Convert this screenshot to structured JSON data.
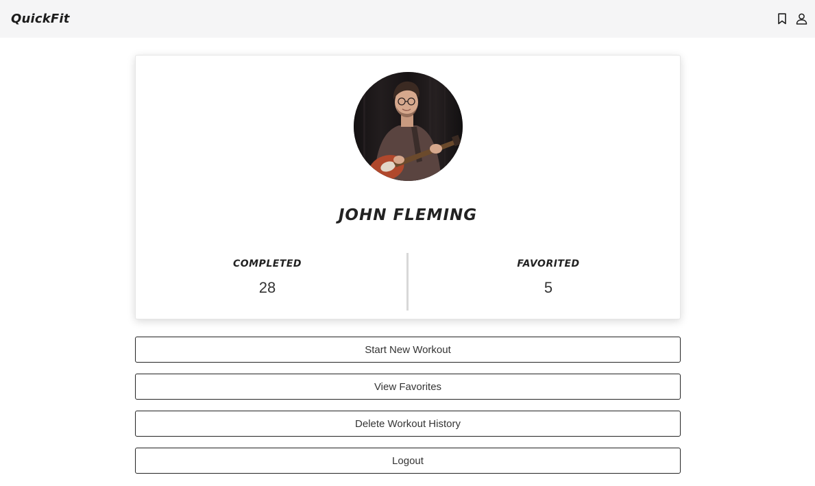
{
  "app": {
    "brand": "QuickFit"
  },
  "navbar": {
    "icons": [
      "bookmark-icon",
      "user-icon"
    ]
  },
  "profile": {
    "name": "JOHN FLEMING",
    "avatar": "profile-photo",
    "stats": {
      "completed_label": "COMPLETED",
      "completed_value": "28",
      "favorited_label": "FAVORITED",
      "favorited_value": "5"
    }
  },
  "actions": {
    "start_new_workout": "Start New Workout",
    "view_favorites": "View Favorites",
    "delete_history": "Delete Workout History",
    "logout": "Logout"
  },
  "colors": {
    "navbar_bg": "#f5f5f6",
    "text": "#222222",
    "button_border": "#222222",
    "divider": "#d8d8d8"
  }
}
